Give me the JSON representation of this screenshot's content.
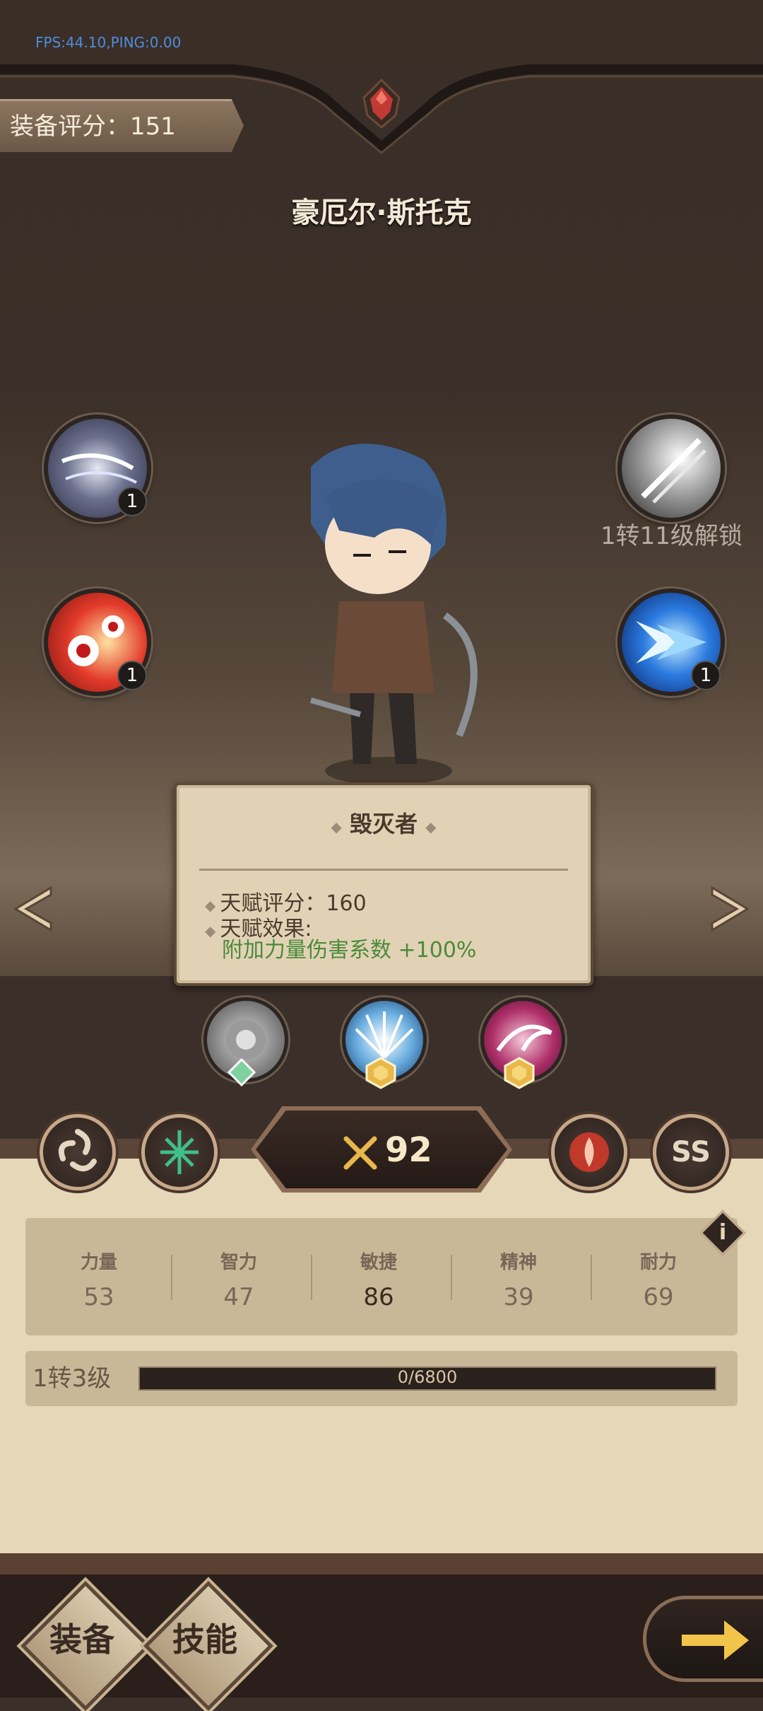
{
  "debug": {
    "fps_text": "FPS:44.10,PING:0.00"
  },
  "header": {
    "score_text": "装备评分：151"
  },
  "hero": {
    "name": "豪厄尔·斯托克"
  },
  "skills": {
    "left_top_level": "1",
    "left_bottom_level": "1",
    "right_bottom_level": "1",
    "right_top_locked_text": "1转11级解锁"
  },
  "talent": {
    "title": "毁灭者",
    "rating_text": "天赋评分：160",
    "effect_label": "天赋效果:",
    "effect_text": "附加力量伤害系数 +100%"
  },
  "class_bar": {
    "power_value": "92",
    "rank_text": "SS"
  },
  "stats": [
    {
      "label": "力量",
      "value": "53"
    },
    {
      "label": "智力",
      "value": "47"
    },
    {
      "label": "敏捷",
      "value": "86"
    },
    {
      "label": "精神",
      "value": "39"
    },
    {
      "label": "耐力",
      "value": "69"
    }
  ],
  "level": {
    "label": "1转3级",
    "xp_text": "0/6800",
    "xp_progress": 0
  },
  "footer": {
    "equip_label": "装备",
    "skill_label": "技能"
  },
  "colors": {
    "accent_green": "#4a8a3a",
    "panel": "#e6d7b8",
    "gold": "#d9a640"
  }
}
